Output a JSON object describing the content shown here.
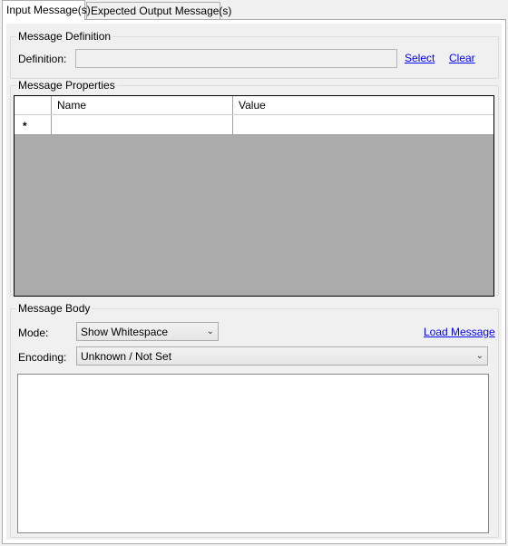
{
  "tabs": [
    {
      "label": "Input Message(s)",
      "active": true
    },
    {
      "label": "Expected Output Message(s)",
      "active": false
    }
  ],
  "message_definition": {
    "group_title": "Message Definition",
    "definition_label": "Definition:",
    "definition_value": "",
    "select_link": "Select",
    "clear_link": "Clear"
  },
  "message_properties": {
    "group_title": "Message Properties",
    "columns": [
      "Name",
      "Value"
    ],
    "new_row_marker": "*",
    "rows": []
  },
  "message_body": {
    "group_title": "Message Body",
    "mode_label": "Mode:",
    "mode_value": "Show Whitespace",
    "load_message_link": "Load Message",
    "encoding_label": "Encoding:",
    "encoding_value": "Unknown / Not Set",
    "body_text": ""
  },
  "icons": {
    "dropdown": "chevron-down-icon"
  },
  "colors": {
    "link": "#0000ff",
    "grid_background": "#ababab",
    "panel_background": "#f0f0f0"
  }
}
